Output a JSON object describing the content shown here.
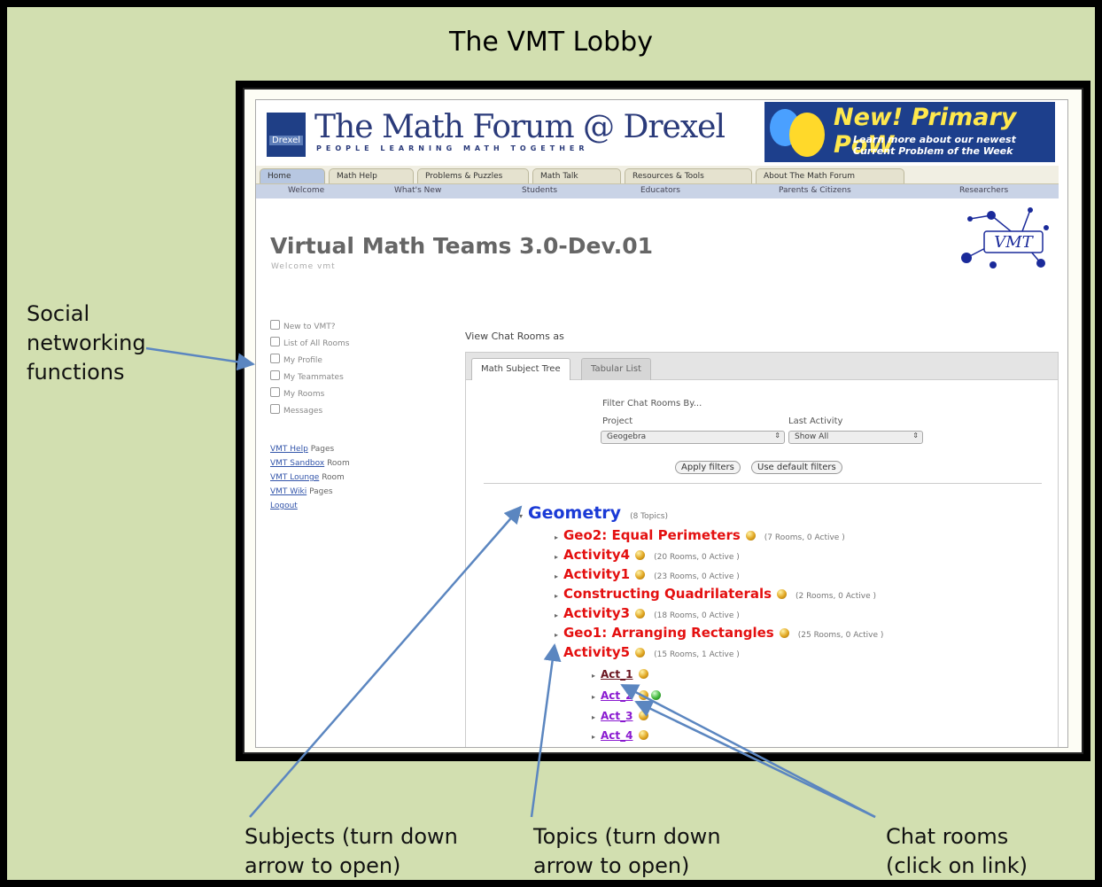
{
  "poster": {
    "title": "The VMT Lobby",
    "background": "#d2dfb0",
    "arrow_color": "#5b86c0",
    "callouts": {
      "social": [
        "Social",
        "networking",
        "functions"
      ],
      "subjects": [
        "Subjects (turn down",
        "arrow to open)"
      ],
      "topics": [
        "Topics (turn down",
        "arrow to open)"
      ],
      "chat": [
        "Chat rooms",
        "(click on link)"
      ]
    }
  },
  "header": {
    "logo_text": "Drexel",
    "site_title": "The Math Forum @ Drexel",
    "tagline": "PEOPLE LEARNING MATH TOGETHER",
    "promo_title": "New! Primary PoW",
    "promo_line1": "Learn more about our newest",
    "promo_line2": "Current Problem of the Week",
    "tabs": [
      "Home",
      "Math Help",
      "Problems & Puzzles",
      "Math Talk",
      "Resources & Tools",
      "About The Math Forum"
    ],
    "subnav": [
      "Welcome",
      "What's New",
      "Students",
      "Educators",
      "Parents & Citizens",
      "Researchers"
    ]
  },
  "page": {
    "title": "Virtual Math Teams 3.0-Dev.01",
    "welcome": "Welcome vmt",
    "logo_text": "VMT"
  },
  "sidebar": {
    "items": [
      "New to VMT?",
      "List of All Rooms",
      "My Profile",
      "My Teammates",
      "My Rooms",
      "Messages"
    ],
    "links": [
      {
        "link": "VMT Help",
        "suffix": "Pages"
      },
      {
        "link": "VMT Sandbox",
        "suffix": "Room"
      },
      {
        "link": "VMT Lounge",
        "suffix": "Room"
      },
      {
        "link": "VMT Wiki",
        "suffix": "Pages"
      },
      {
        "link": "Logout",
        "suffix": ""
      }
    ]
  },
  "chat": {
    "view_label": "View Chat Rooms as",
    "tab_tree": "Math Subject Tree",
    "tab_list": "Tabular List",
    "filter_title": "Filter Chat Rooms By...",
    "project_label": "Project",
    "project_value": "Geogebra",
    "activity_label": "Last Activity",
    "activity_value": "Show All",
    "apply_button": "Apply filters",
    "default_button": "Use default filters"
  },
  "tree": {
    "subject": {
      "name": "Geometry",
      "count": "(8 Topics)"
    },
    "topics": [
      {
        "name": "Geo2: Equal Perimeters",
        "count": "(7 Rooms, 0 Active )"
      },
      {
        "name": "Activity4",
        "count": "(20 Rooms, 0 Active )"
      },
      {
        "name": "Activity1",
        "count": "(23 Rooms, 0 Active )"
      },
      {
        "name": "Constructing Quadrilaterals",
        "count": "(2 Rooms, 0 Active )"
      },
      {
        "name": "Activity3",
        "count": "(18 Rooms, 0 Active )"
      },
      {
        "name": "Geo1: Arranging Rectangles",
        "count": "(25 Rooms, 0 Active )"
      },
      {
        "name": "Activity5",
        "count": "(15 Rooms, 1 Active )"
      }
    ],
    "rooms": [
      "Act_1",
      "Act_2",
      "Act_3",
      "Act_4"
    ]
  }
}
